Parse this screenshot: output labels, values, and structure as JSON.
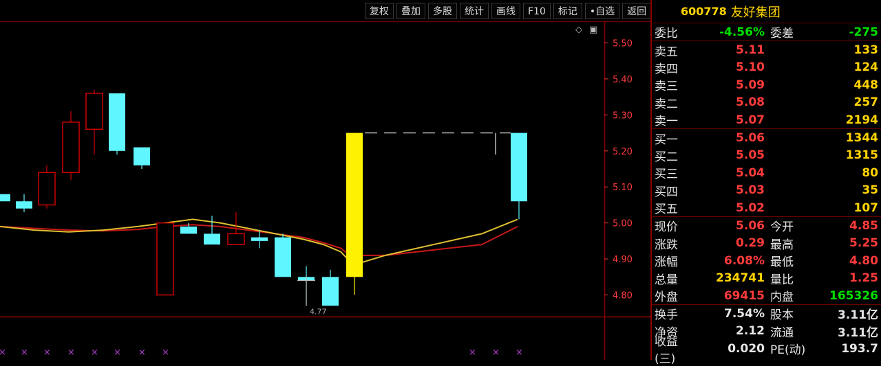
{
  "toolbar": [
    "复权",
    "叠加",
    "多股",
    "统计",
    "画线",
    "F10",
    "标记",
    "•自选",
    "返回"
  ],
  "chart": {
    "corner_icons": [
      "◇",
      "▣"
    ],
    "price_axis": [
      "5.50",
      "5.40",
      "5.30",
      "5.20",
      "5.10",
      "5.00",
      "4.90",
      "4.80"
    ],
    "low_annotation": "4.77",
    "colors": {
      "up": "#d00000",
      "down": "#5ff6ff",
      "limit_up": "#fff200",
      "ma_fast": "#e0c030",
      "ma_slow": "#c81818"
    }
  },
  "chart_data": {
    "type": "candlestick",
    "ylim": [
      4.74,
      5.56
    ],
    "candles": [
      {
        "o": 5.08,
        "h": 5.08,
        "l": 5.06,
        "c": 5.06
      },
      {
        "o": 5.06,
        "h": 5.08,
        "l": 5.03,
        "c": 5.04
      },
      {
        "o": 5.05,
        "h": 5.16,
        "l": 5.04,
        "c": 5.14
      },
      {
        "o": 5.14,
        "h": 5.31,
        "l": 5.12,
        "c": 5.28
      },
      {
        "o": 5.26,
        "h": 5.37,
        "l": 5.19,
        "c": 5.36
      },
      {
        "o": 5.36,
        "h": 5.36,
        "l": 5.19,
        "c": 5.2
      },
      {
        "o": 5.21,
        "h": 5.21,
        "l": 5.15,
        "c": 5.16
      },
      {
        "o": 4.8,
        "h": 5.0,
        "l": 4.8,
        "c": 5.0
      },
      {
        "o": 4.99,
        "h": 5.0,
        "l": 4.97,
        "c": 4.97
      },
      {
        "o": 4.97,
        "h": 5.02,
        "l": 4.94,
        "c": 4.94
      },
      {
        "o": 4.94,
        "h": 5.03,
        "l": 4.94,
        "c": 4.97
      },
      {
        "o": 4.96,
        "h": 4.98,
        "l": 4.93,
        "c": 4.95
      },
      {
        "o": 4.96,
        "h": 4.97,
        "l": 4.85,
        "c": 4.85
      },
      {
        "o": 4.85,
        "h": 4.88,
        "l": 4.77,
        "c": 4.84
      },
      {
        "o": 4.85,
        "h": 4.87,
        "l": 4.77,
        "c": 4.77
      },
      {
        "o": 4.85,
        "h": 5.25,
        "l": 4.8,
        "c": 5.25
      },
      {
        "o": 5.25,
        "h": 5.25,
        "l": 5.01,
        "c": 5.06
      }
    ]
  },
  "quote": {
    "code": "600778",
    "name": "友好集团",
    "weibi": {
      "label": "委比",
      "value": "-4.56%",
      "label2": "委差",
      "value2": "-275"
    },
    "sells": [
      {
        "label": "卖五",
        "price": "5.11",
        "vol": "133"
      },
      {
        "label": "卖四",
        "price": "5.10",
        "vol": "124"
      },
      {
        "label": "卖三",
        "price": "5.09",
        "vol": "448"
      },
      {
        "label": "卖二",
        "price": "5.08",
        "vol": "257"
      },
      {
        "label": "卖一",
        "price": "5.07",
        "vol": "2194"
      }
    ],
    "buys": [
      {
        "label": "买一",
        "price": "5.06",
        "vol": "1344"
      },
      {
        "label": "买二",
        "price": "5.05",
        "vol": "1315"
      },
      {
        "label": "买三",
        "price": "5.04",
        "vol": "80"
      },
      {
        "label": "买四",
        "price": "5.03",
        "vol": "35"
      },
      {
        "label": "买五",
        "price": "5.02",
        "vol": "107"
      }
    ],
    "stats1": [
      {
        "l1": "现价",
        "v1": "5.06",
        "c1": "red",
        "l2": "今开",
        "v2": "4.85",
        "c2": "red"
      },
      {
        "l1": "涨跌",
        "v1": "0.29",
        "c1": "red",
        "l2": "最高",
        "v2": "5.25",
        "c2": "red"
      },
      {
        "l1": "涨幅",
        "v1": "6.08%",
        "c1": "red",
        "l2": "最低",
        "v2": "4.80",
        "c2": "red"
      },
      {
        "l1": "总量",
        "v1": "234741",
        "c1": "yellow",
        "l2": "量比",
        "v2": "1.25",
        "c2": "red"
      },
      {
        "l1": "外盘",
        "v1": "69415",
        "c1": "red",
        "l2": "内盘",
        "v2": "165326",
        "c2": "green"
      }
    ],
    "stats2": [
      {
        "l1": "换手",
        "v1": "7.54%",
        "l2": "股本",
        "v2": "3.11亿"
      },
      {
        "l1": "净资",
        "v1": "2.12",
        "l2": "流通",
        "v2": "3.11亿"
      },
      {
        "l1": "收益(三)",
        "v1": "0.020",
        "l2": "PE(动)",
        "v2": "193.7"
      }
    ]
  }
}
